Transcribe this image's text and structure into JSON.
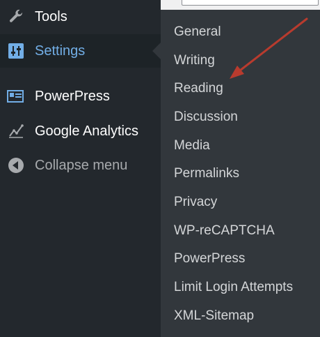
{
  "sidebar": {
    "items": [
      {
        "label": "Tools",
        "icon": "wrench-icon"
      },
      {
        "label": "Settings",
        "icon": "settings-sliders-icon",
        "active": true
      },
      {
        "label": "PowerPress",
        "icon": "powerpress-icon"
      },
      {
        "label": "Google Analytics",
        "icon": "analytics-chart-icon"
      },
      {
        "label": "Collapse menu",
        "icon": "collapse-arrow-icon"
      }
    ]
  },
  "submenu": {
    "items": [
      {
        "label": "General"
      },
      {
        "label": "Writing"
      },
      {
        "label": "Reading"
      },
      {
        "label": "Discussion"
      },
      {
        "label": "Media"
      },
      {
        "label": "Permalinks"
      },
      {
        "label": "Privacy"
      },
      {
        "label": "WP-reCAPTCHA"
      },
      {
        "label": "PowerPress"
      },
      {
        "label": "Limit Login Attempts"
      },
      {
        "label": "XML-Sitemap"
      }
    ]
  },
  "colors": {
    "sidebar_bg": "#23282d",
    "submenu_bg": "#32373c",
    "active_label": "#72aee6",
    "active_icon": "#72aee6",
    "annotation_arrow": "#b83b2e"
  }
}
